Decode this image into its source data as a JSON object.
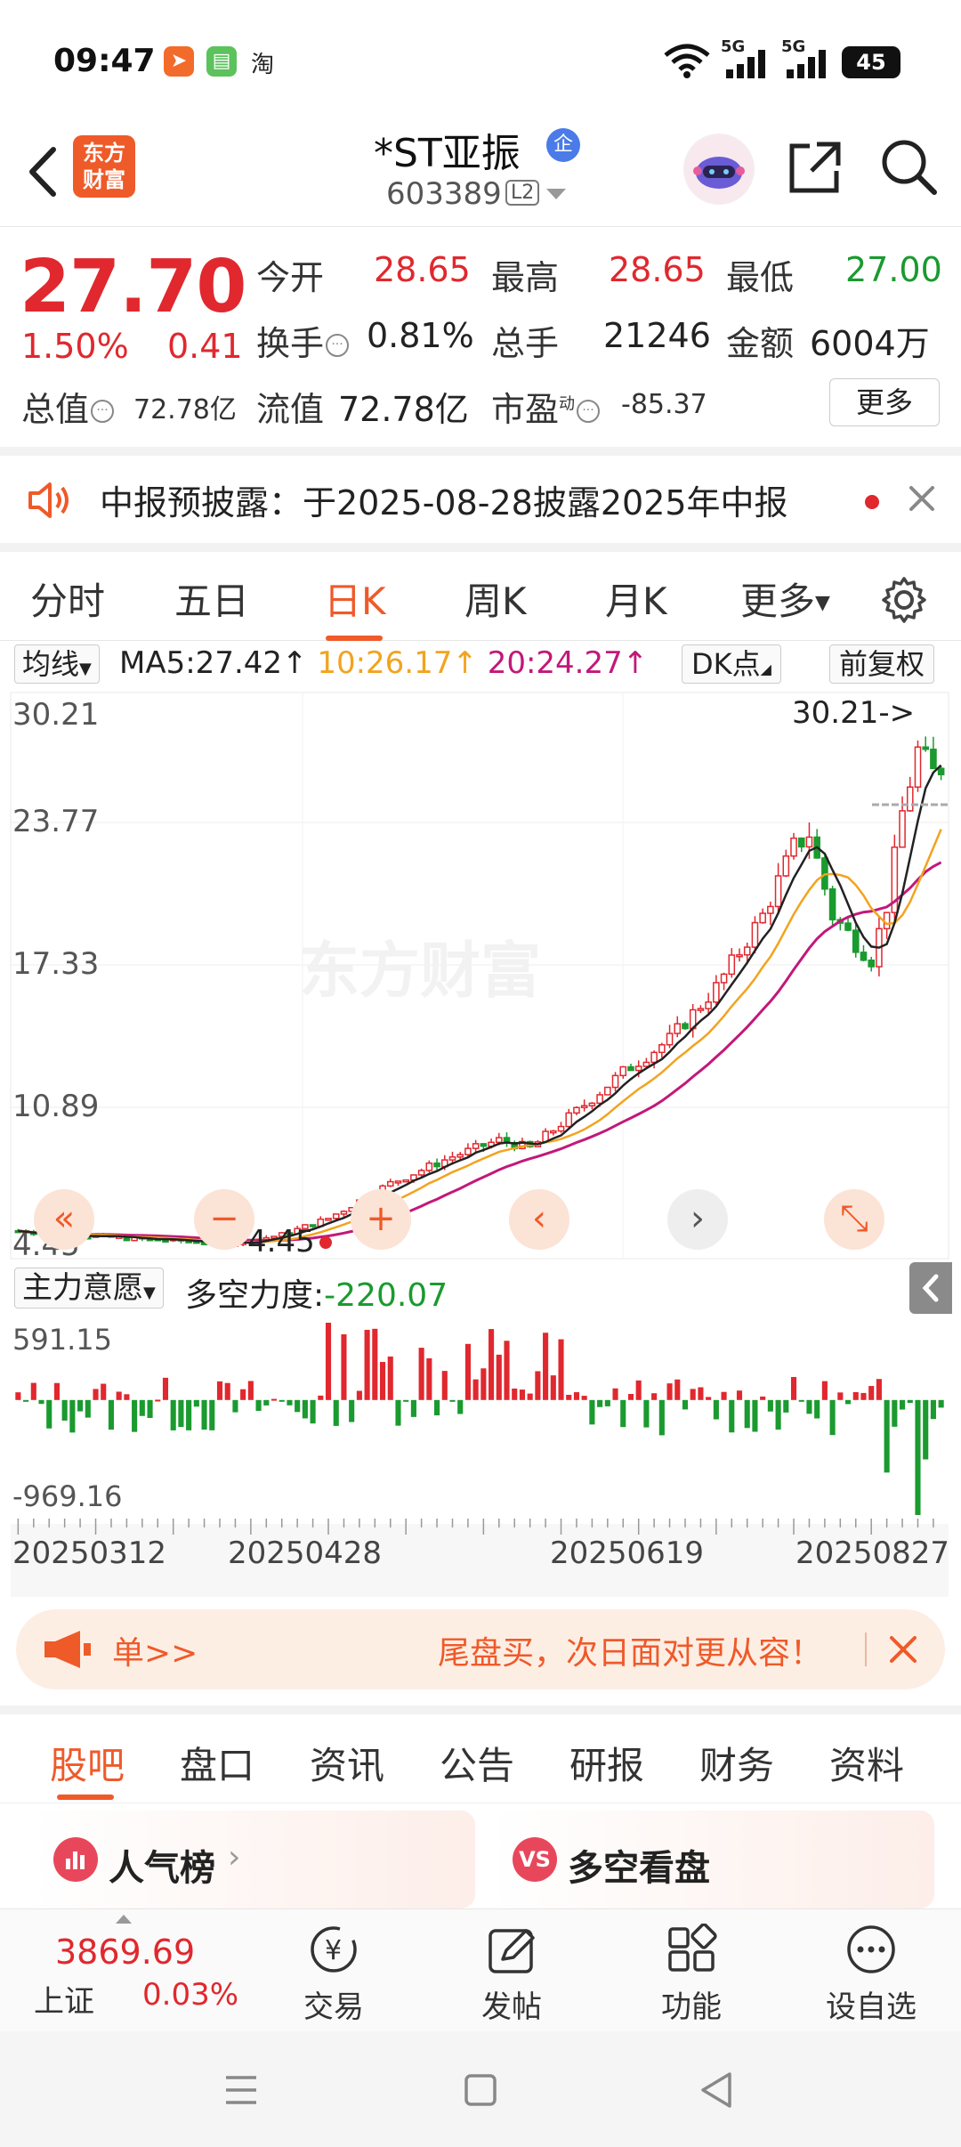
{
  "status_bar": {
    "time": "09:47",
    "app_icons": [
      "feishu-icon",
      "messages-icon",
      "taobao-icon"
    ],
    "taobao_label": "淘",
    "network_1": "5G",
    "network_2": "5G",
    "battery": "45"
  },
  "header": {
    "logo_line1": "东方",
    "logo_line2": "财富",
    "stock_name": "*ST亚振",
    "verify_badge": "企",
    "stock_code": "603389",
    "level_badge": "L2"
  },
  "quote": {
    "last_price": "27.70",
    "change_pct": "1.50%",
    "change_amt": "0.41",
    "open_label": "今开",
    "open": "28.65",
    "high_label": "最高",
    "high": "28.65",
    "low_label": "最低",
    "low": "27.00",
    "turnover_label": "换手",
    "turnover": "0.81%",
    "volume_label": "总手",
    "volume": "21246",
    "amount_label": "金额",
    "amount": "6004万",
    "mktcap_label": "总值",
    "mktcap": "72.78亿",
    "float_label": "流值",
    "float_cap": "72.78亿",
    "pe_label": "市盈",
    "pe_sup": "动",
    "pe": "-85.37",
    "more_label": "更多"
  },
  "notice": {
    "text": "中报预披露：于2025-08-28披露2025年中报"
  },
  "chart_tabs": [
    "分时",
    "五日",
    "日K",
    "周K",
    "月K",
    "更多"
  ],
  "chart_tab_active": "日K",
  "ma_row": {
    "selector": "均线",
    "ma5": "MA5:27.42↑",
    "ma10": "10:26.17↑",
    "ma20": "20:24.27↑",
    "dk_label": "DK点",
    "adjust_label": "前复权",
    "ma5_color": "#222222",
    "ma10_color": "#f2a31f",
    "ma20_color": "#c2187a"
  },
  "chart_labels": {
    "y_ticks": [
      "30.21",
      "23.77",
      "17.33",
      "10.89",
      "4.45"
    ],
    "high_marker": "30.21->",
    "low_marker": "4.45",
    "watermark": "东方财富",
    "indicator_selector": "主力意愿",
    "indicator_name": "多空力度:",
    "indicator_value": "-220.07",
    "ind_max": "591.15",
    "ind_min": "-969.16",
    "x_ticks": [
      "20250312",
      "20250428",
      "20250619",
      "20250827"
    ]
  },
  "chart_data": {
    "type": "candlestick",
    "y_range": [
      4.45,
      30.21
    ],
    "ma_colors": {
      "ma5": "#222222",
      "ma10": "#f2a31f",
      "ma20": "#c2187a"
    },
    "last_close": 27.7,
    "period_high": 30.21,
    "period_low": 4.45,
    "indicator_range": [
      -969.16,
      591.15
    ],
    "indicator_last": -220.07,
    "x_ticks": [
      "20250312",
      "20250428",
      "20250619",
      "20250827"
    ]
  },
  "ad_banner": {
    "left_text": "单>>",
    "right_text": "尾盘买，次日面对更从容！"
  },
  "bottom_tabs": [
    "股吧",
    "盘口",
    "资讯",
    "公告",
    "研报",
    "财务",
    "资料"
  ],
  "bottom_tab_active": "股吧",
  "cards": {
    "left_title": "人气榜",
    "left_icon_text": "",
    "right_title": "多空看盘",
    "right_icon_text": "VS"
  },
  "toolbar": {
    "index_value": "3869.69",
    "index_name": "上证",
    "index_change": "0.03%",
    "trade": "交易",
    "post": "发帖",
    "features": "功能",
    "watchlist": "设自选",
    "trade_glyph": "¥"
  },
  "colors": {
    "accent": "#ef5a29",
    "up": "#e0282e",
    "down": "#1a9a2f"
  }
}
